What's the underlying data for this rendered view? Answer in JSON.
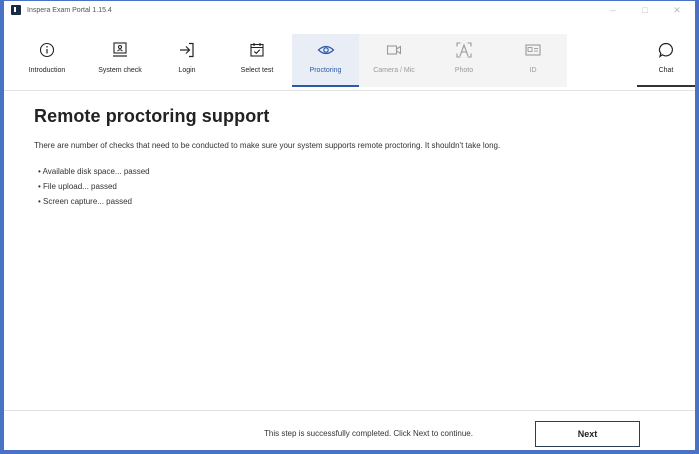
{
  "window": {
    "title": "Inspera Exam Portal 1.15.4",
    "controls": {
      "minimize": "–",
      "maximize": "□",
      "close": "✕"
    }
  },
  "steps": [
    {
      "label": "Introduction",
      "icon": "info-icon",
      "state": "done"
    },
    {
      "label": "System check",
      "icon": "computer-check-icon",
      "state": "done"
    },
    {
      "label": "Login",
      "icon": "login-arrow-icon",
      "state": "done"
    },
    {
      "label": "Select test",
      "icon": "calendar-check-icon",
      "state": "done"
    },
    {
      "label": "Proctoring",
      "icon": "eye-icon",
      "state": "active"
    },
    {
      "label": "Camera / Mic",
      "icon": "camera-icon",
      "state": "disabled"
    },
    {
      "label": "Photo",
      "icon": "face-scan-icon",
      "state": "disabled"
    },
    {
      "label": "ID",
      "icon": "id-card-icon",
      "state": "disabled"
    }
  ],
  "chat": {
    "label": "Chat",
    "icon": "chat-bubble-icon"
  },
  "main": {
    "title": "Remote proctoring support",
    "intro": "There are number of checks that need to be conducted to make sure your system supports remote proctoring. It shouldn't take long.",
    "checks": [
      "Available disk space... passed",
      "File upload... passed",
      "Screen capture... passed"
    ]
  },
  "footer": {
    "message": "This step is successfully completed. Click Next to continue.",
    "next_label": "Next"
  },
  "colors": {
    "accent": "#2b5aa8",
    "window_border": "#4a72c4",
    "disabled_text": "#9a9a9a"
  }
}
